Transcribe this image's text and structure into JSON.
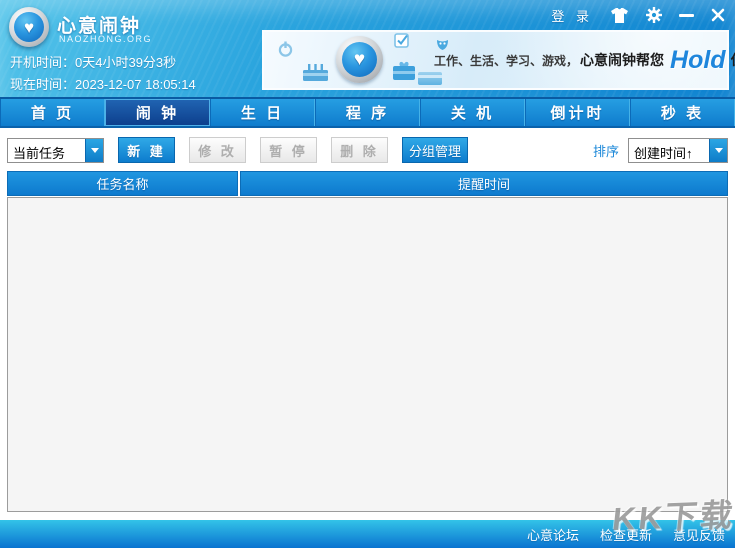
{
  "app": {
    "title": "心意闹钟",
    "subtitle": "NAOZHONG.ORG"
  },
  "topbar": {
    "login_label": "登 录",
    "boot_time_label": "开机时间：",
    "boot_time_value": "0天4小时39分3秒",
    "current_time_label": "现在时间：",
    "current_time_value": "2023-12-07 18:05:14"
  },
  "banner": {
    "slogan_prefix": "工作、生活、学习、游戏，",
    "slogan_bold": "心意闹钟帮您",
    "slogan_highlight": "Hold",
    "slogan_suffix": "住!"
  },
  "tabs": [
    {
      "label": "首 页",
      "active": false
    },
    {
      "label": "闹 钟",
      "active": true
    },
    {
      "label": "生 日",
      "active": false
    },
    {
      "label": "程 序",
      "active": false
    },
    {
      "label": "关 机",
      "active": false
    },
    {
      "label": "倒计时",
      "active": false
    },
    {
      "label": "秒 表",
      "active": false
    }
  ],
  "toolbar": {
    "filter_value": "当前任务",
    "new_label": "新 建",
    "modify_label": "修 改",
    "pause_label": "暂 停",
    "delete_label": "删 除",
    "group_label": "分组管理",
    "sort_label": "排序",
    "sort_value": "创建时间↑"
  },
  "table": {
    "columns": [
      "任务名称",
      "提醒时间"
    ],
    "rows": []
  },
  "footer": {
    "links": [
      "心意论坛",
      "检查更新",
      "意见反馈"
    ]
  },
  "watermark": "KK下载",
  "icons": {
    "heart": "♥"
  },
  "colors": {
    "topbar_blue": "#0e82d0",
    "tab_active_blue": "#0c3e8c",
    "accent_blue": "#0d7ccd",
    "link_blue": "#1a87d8",
    "hold_blue": "#1e86dc",
    "footer_blue_top": "#33c3e8",
    "footer_blue_bottom": "#0a73d0"
  }
}
